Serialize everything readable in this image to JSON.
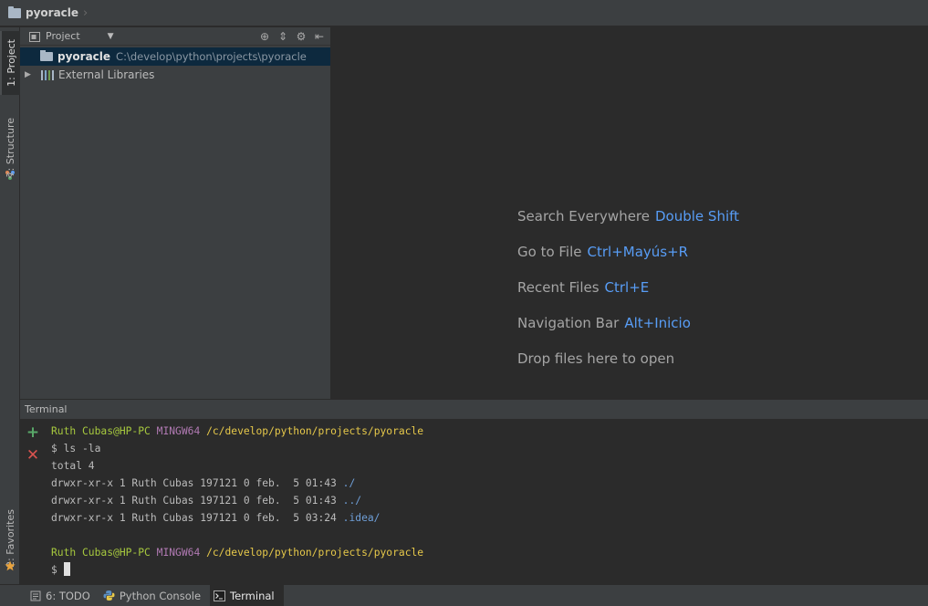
{
  "navbar": {
    "project_name": "pyoracle"
  },
  "left_strip": {
    "project_tab": "1: Project",
    "structure_tab": "7: Structure",
    "favorites_tab": "2: Favorites"
  },
  "project_panel": {
    "view_label": "Project",
    "root": {
      "name": "pyoracle",
      "path": "C:\\develop\\python\\projects\\pyoracle"
    },
    "external_libraries": "External Libraries"
  },
  "editor": {
    "hints": [
      {
        "label": "Search Everywhere",
        "shortcut": "Double Shift"
      },
      {
        "label": "Go to File",
        "shortcut": "Ctrl+Mayús+R"
      },
      {
        "label": "Recent Files",
        "shortcut": "Ctrl+E"
      },
      {
        "label": "Navigation Bar",
        "shortcut": "Alt+Inicio"
      },
      {
        "label": "Drop files here to open",
        "shortcut": ""
      }
    ]
  },
  "terminal": {
    "title": "Terminal",
    "prompt1": {
      "user": "Ruth Cubas@HP-PC",
      "system": "MINGW64",
      "path": "/c/develop/python/projects/pyoracle"
    },
    "command1": "$ ls -la",
    "total": "total 4",
    "entries": [
      {
        "meta": "drwxr-xr-x 1 Ruth Cubas 197121 0 feb.  5 01:43 ",
        "name": "./"
      },
      {
        "meta": "drwxr-xr-x 1 Ruth Cubas 197121 0 feb.  5 01:43 ",
        "name": "../"
      },
      {
        "meta": "drwxr-xr-x 1 Ruth Cubas 197121 0 feb.  5 03:24 ",
        "name": ".idea/"
      }
    ],
    "prompt2": {
      "user": "Ruth Cubas@HP-PC",
      "system": "MINGW64",
      "path": "/c/develop/python/projects/pyoracle"
    },
    "current_prompt": "$ "
  },
  "bottom_bar": {
    "todo": "6: TODO",
    "python_console": "Python Console",
    "terminal": "Terminal"
  },
  "colors": {
    "accent_shortcut": "#589df6",
    "terminal_user": "#a6c83e",
    "terminal_path": "#e6c84a",
    "selection": "#0d293e"
  }
}
